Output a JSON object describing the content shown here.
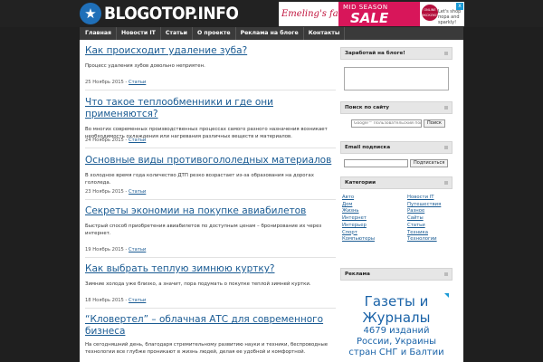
{
  "site": {
    "logo_text": "BLOGOTOP.INFO",
    "logo_icon": "star-icon"
  },
  "top_ad": {
    "brand": "Emeling's family",
    "mid": "MID SEASON",
    "sale": "SALE",
    "badge": "ONLINE ЭКСКЛЮЗИВ",
    "shop": "Let's shop пора and sparkly!"
  },
  "nav": {
    "items": [
      "Главная",
      "Новости IT",
      "Статьи",
      "О проекте",
      "Реклама на блоге",
      "Контакты"
    ]
  },
  "posts": [
    {
      "title": "Как происходит удаление зуба?",
      "excerpt": "Процесс удаления зубов довольно неприятен.",
      "date": "25 Ноябрь 2015 -",
      "category": "Статьи"
    },
    {
      "title": "Что такое теплообменники и где они применяются?",
      "excerpt": "Во многих современных производственных процессах самого разного назначения возникает необходимость охлаждения или нагревания различных веществ и материалов.",
      "date": "24 Ноябрь 2015 -",
      "category": "Статьи"
    },
    {
      "title": "Основные виды противогололедных материалов",
      "excerpt": "В холодное время года количество ДТП резко возрастает из-за образования на дорогах гололеда.",
      "date": "23 Ноябрь 2015 -",
      "category": "Статьи"
    },
    {
      "title": "Секреты экономии на покупке авиабилетов",
      "excerpt": "Быстрый способ приобретения авиабилетов по доступным ценам – бронирование их через интернет.",
      "date": "19 Ноябрь 2015 -",
      "category": "Статьи"
    },
    {
      "title": "Как выбрать теплую зимнюю куртку?",
      "excerpt": "Зимние холода уже близко, а значит, пора подумать о покупке теплой зимней куртки.",
      "date": "18 Ноябрь 2015 -",
      "category": "Статьи"
    },
    {
      "title": "“Кловертел” – облачная АТС для современного бизнеса",
      "excerpt": "На сегодняшний день, благодаря стремительному развитию науки и техники, беспроводные технологии все глубже проникают в жизнь людей, делая ее удобной и комфортной.",
      "date": "",
      "category": ""
    }
  ],
  "sidebar": {
    "earn": {
      "title": "Заработай на блоге!"
    },
    "search": {
      "title": "Поиск по сайту",
      "placeholder": "Google™ Пользовательский поиск",
      "button": "Поиск"
    },
    "email": {
      "title": "Email подписка",
      "button": "Подписаться"
    },
    "categories": {
      "title": "Категории",
      "left": [
        "Авто",
        "Дом",
        "Жизнь",
        "Интернет",
        "Интерьер",
        "Спорт",
        "Компьютеры"
      ],
      "right": [
        "Новости IT",
        "Путешествия",
        "Разное",
        "Сайты",
        "Статьи",
        "Техника",
        "Технологии"
      ]
    },
    "ads": {
      "title": "Реклама",
      "line1": "Газеты и",
      "line2": "Журналы",
      "line3": "4679 изданий",
      "line4": "России, Украины",
      "line5": "стран СНГ и Балтии"
    }
  },
  "colors": {
    "link": "#1a5b93",
    "header_bg": "#222222",
    "nav_bg": "#3a3a3a",
    "sale_pink": "#d8165a"
  }
}
